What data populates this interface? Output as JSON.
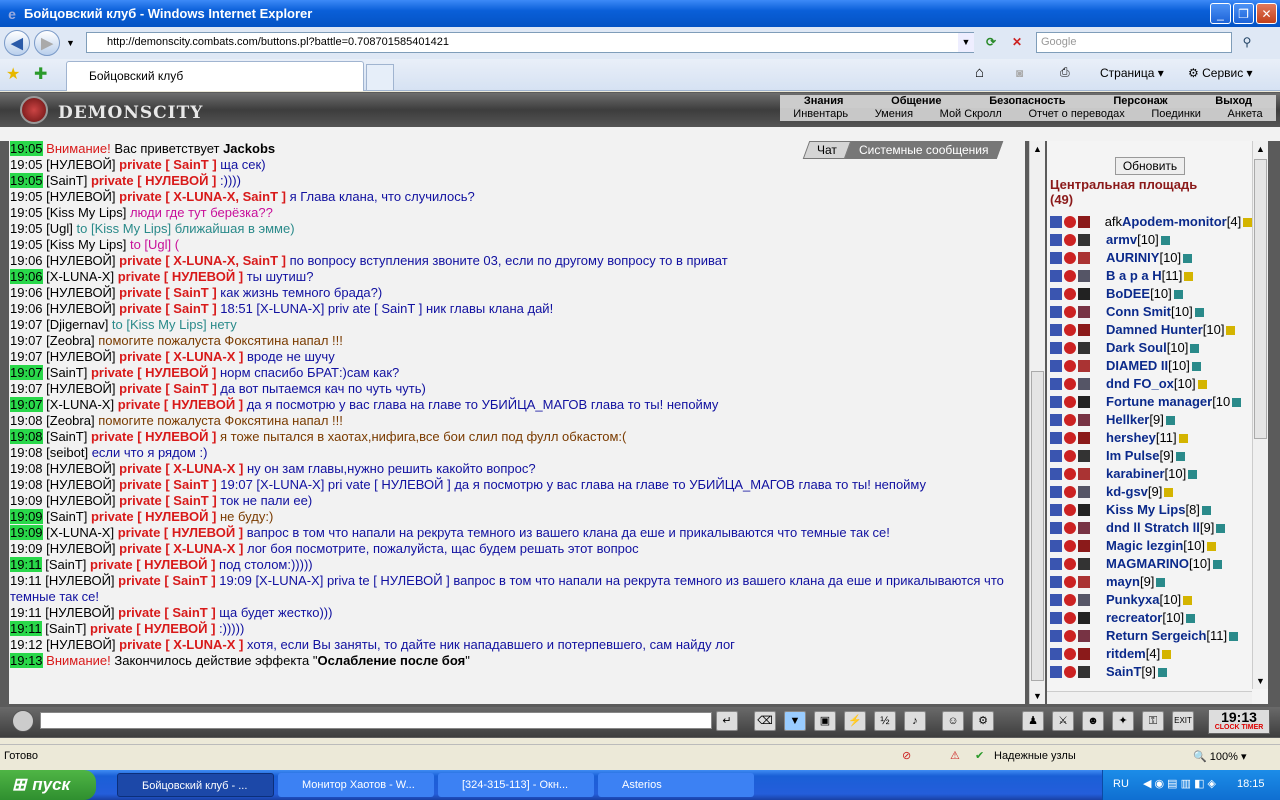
{
  "window": {
    "title": "Бойцовский клуб - Windows Internet Explorer"
  },
  "nav": {
    "url": "http://demonscity.combats.com/buttons.pl?battle=0.708701585401421",
    "search_placeholder": "Google"
  },
  "tabs": {
    "active": "Бойцовский клуб"
  },
  "commandbar": {
    "page": "Страница",
    "tools": "Сервис"
  },
  "game": {
    "logo": "DEMONSCITY",
    "topmenu": [
      "Знания",
      "Общение",
      "Безопасность",
      "Персонаж",
      "Выход"
    ],
    "submenu": [
      "Инвентарь",
      "Умения",
      "Мой Скролл",
      "Отчет о переводах",
      "Поединки",
      "Анкета"
    ],
    "chat_tabs": [
      "Чат",
      "Системные сообщения"
    ],
    "chat": [
      {
        "time": "19:05",
        "hl": true,
        "parts": [
          {
            "c": "wn",
            "t": "Внимание! "
          },
          {
            "c": "",
            "t": "Вас приветствует "
          },
          {
            "c": "b",
            "t": "Jackobs"
          }
        ]
      },
      {
        "time": "19:05",
        "hl": false,
        "parts": [
          {
            "c": "",
            "t": "[НУЛЕВОЙ] "
          },
          {
            "c": "pv",
            "t": "private [ SainT ]"
          },
          {
            "c": "tx",
            "t": " ща сек)"
          }
        ]
      },
      {
        "time": "19:05",
        "hl": true,
        "parts": [
          {
            "c": "",
            "t": "[SainT] "
          },
          {
            "c": "pv",
            "t": "private [ НУЛЕВОЙ ]"
          },
          {
            "c": "tx",
            "t": " :))))"
          }
        ]
      },
      {
        "time": "19:05",
        "hl": false,
        "parts": [
          {
            "c": "",
            "t": "[НУЛЕВОЙ] "
          },
          {
            "c": "pv",
            "t": "private [ X-LUNA-X, SainT ]"
          },
          {
            "c": "tx",
            "t": " я Глава клана, что случилось?"
          }
        ]
      },
      {
        "time": "19:05",
        "hl": false,
        "parts": [
          {
            "c": "",
            "t": "[Kiss My Lips] "
          },
          {
            "c": "mg",
            "t": "люди где тут берёзка??"
          }
        ]
      },
      {
        "time": "19:05",
        "hl": false,
        "parts": [
          {
            "c": "",
            "t": "[Ugl] "
          },
          {
            "c": "gr",
            "t": "to [Kiss My Lips] ближайшая в эмме)"
          }
        ]
      },
      {
        "time": "19:05",
        "hl": false,
        "parts": [
          {
            "c": "",
            "t": "[Kiss My Lips] "
          },
          {
            "c": "mg",
            "t": "to [Ugl] ("
          }
        ]
      },
      {
        "time": "19:06",
        "hl": false,
        "parts": [
          {
            "c": "",
            "t": "[НУЛЕВОЙ] "
          },
          {
            "c": "pv",
            "t": "private [ X-LUNA-X, SainT ]"
          },
          {
            "c": "tx",
            "t": " по вопросу вступления звоните 03, если по другому вопросу то в приват"
          }
        ]
      },
      {
        "time": "19:06",
        "hl": true,
        "parts": [
          {
            "c": "",
            "t": "[X-LUNA-X] "
          },
          {
            "c": "pv",
            "t": "private [ НУЛЕВОЙ ]"
          },
          {
            "c": "tx",
            "t": " ты шутиш?"
          }
        ]
      },
      {
        "time": "19:06",
        "hl": false,
        "parts": [
          {
            "c": "",
            "t": "[НУЛЕВОЙ] "
          },
          {
            "c": "pv",
            "t": "private [ SainT ]"
          },
          {
            "c": "tx",
            "t": " как жизнь темного брада?)"
          }
        ]
      },
      {
        "time": "19:06",
        "hl": false,
        "parts": [
          {
            "c": "",
            "t": "[НУЛЕВОЙ] "
          },
          {
            "c": "pv",
            "t": "private [ SainT ]"
          },
          {
            "c": "tx",
            "t": " 18:51 [X-LUNA-X] priv ate [ SainT ] ник главы клана дай!"
          }
        ]
      },
      {
        "time": "19:07",
        "hl": false,
        "parts": [
          {
            "c": "",
            "t": "[Djigernav] "
          },
          {
            "c": "gr",
            "t": "to [Kiss My Lips] нету"
          }
        ]
      },
      {
        "time": "19:07",
        "hl": false,
        "parts": [
          {
            "c": "",
            "t": "[Zeobra] "
          },
          {
            "c": "br",
            "t": "помогите пожалуста Фоксятина напал !!!"
          }
        ]
      },
      {
        "time": "19:07",
        "hl": false,
        "parts": [
          {
            "c": "",
            "t": "[НУЛЕВОЙ] "
          },
          {
            "c": "pv",
            "t": "private [ X-LUNA-X ]"
          },
          {
            "c": "tx",
            "t": " вроде не шучу"
          }
        ]
      },
      {
        "time": "19:07",
        "hl": true,
        "parts": [
          {
            "c": "",
            "t": "[SainT] "
          },
          {
            "c": "pv",
            "t": "private [ НУЛЕВОЙ ]"
          },
          {
            "c": "tx",
            "t": " норм спасибо БРАТ:)сам как?"
          }
        ]
      },
      {
        "time": "19:07",
        "hl": false,
        "parts": [
          {
            "c": "",
            "t": "[НУЛЕВОЙ] "
          },
          {
            "c": "pv",
            "t": "private [ SainT ]"
          },
          {
            "c": "tx",
            "t": " да вот пытаемся кач по чуть чуть)"
          }
        ]
      },
      {
        "time": "19:07",
        "hl": true,
        "parts": [
          {
            "c": "",
            "t": "[X-LUNA-X] "
          },
          {
            "c": "pv",
            "t": "private [ НУЛЕВОЙ ]"
          },
          {
            "c": "tx",
            "t": " да я посмотрю у вас глава на главе то УБИЙЦА_МАГОВ глава то ты! непойму"
          }
        ]
      },
      {
        "time": "19:08",
        "hl": false,
        "parts": [
          {
            "c": "",
            "t": "[Zeobra] "
          },
          {
            "c": "br",
            "t": "помогите пожалуста Фоксятина напал !!!"
          }
        ]
      },
      {
        "time": "19:08",
        "hl": true,
        "parts": [
          {
            "c": "",
            "t": "[SainT] "
          },
          {
            "c": "pv",
            "t": "private [ НУЛЕВОЙ ]"
          },
          {
            "c": "br",
            "t": " я тоже пытался в хаотах,нифига,все бои слил под фулл обкастом:("
          }
        ]
      },
      {
        "time": "19:08",
        "hl": false,
        "parts": [
          {
            "c": "",
            "t": "[seibot] "
          },
          {
            "c": "tx",
            "t": "если что я рядом :)"
          }
        ]
      },
      {
        "time": "19:08",
        "hl": false,
        "parts": [
          {
            "c": "",
            "t": "[НУЛЕВОЙ] "
          },
          {
            "c": "pv",
            "t": "private [ X-LUNA-X ]"
          },
          {
            "c": "tx",
            "t": " ну он зам главы,нужно решить какойто вопрос?"
          }
        ]
      },
      {
        "time": "19:08",
        "hl": false,
        "parts": [
          {
            "c": "",
            "t": "[НУЛЕВОЙ] "
          },
          {
            "c": "pv",
            "t": "private [ SainT ]"
          },
          {
            "c": "tx",
            "t": " 19:07 [X-LUNA-X] pri vate [ НУЛЕВОЙ ] да я посмотрю у вас глава на главе то УБИЙЦА_МАГОВ глава то ты! непойму"
          }
        ]
      },
      {
        "time": "19:09",
        "hl": false,
        "parts": [
          {
            "c": "",
            "t": "[НУЛЕВОЙ] "
          },
          {
            "c": "pv",
            "t": "private [ SainT ]"
          },
          {
            "c": "tx",
            "t": " ток не пали ее)"
          }
        ]
      },
      {
        "time": "19:09",
        "hl": true,
        "parts": [
          {
            "c": "",
            "t": "[SainT] "
          },
          {
            "c": "pv",
            "t": "private [ НУЛЕВОЙ ]"
          },
          {
            "c": "br",
            "t": " не буду:)"
          }
        ]
      },
      {
        "time": "19:09",
        "hl": true,
        "parts": [
          {
            "c": "",
            "t": "[X-LUNA-X] "
          },
          {
            "c": "pv",
            "t": "private [ НУЛЕВОЙ ]"
          },
          {
            "c": "tx",
            "t": " вапрос в том что напали на рекрута темного из вашего клана да еше и прикалываются что темные так се!"
          }
        ]
      },
      {
        "time": "19:09",
        "hl": false,
        "parts": [
          {
            "c": "",
            "t": "[НУЛЕВОЙ] "
          },
          {
            "c": "pv",
            "t": "private [ X-LUNA-X ]"
          },
          {
            "c": "tx",
            "t": " лог боя посмотрите, пожалуйста, щас будем решать этот вопрос"
          }
        ]
      },
      {
        "time": "19:11",
        "hl": true,
        "parts": [
          {
            "c": "",
            "t": "[SainT] "
          },
          {
            "c": "pv",
            "t": "private [ НУЛЕВОЙ ]"
          },
          {
            "c": "tx",
            "t": " под столом:)))))"
          }
        ]
      },
      {
        "time": "19:11",
        "hl": false,
        "parts": [
          {
            "c": "",
            "t": "[НУЛЕВОЙ] "
          },
          {
            "c": "pv",
            "t": "private [ SainT ]"
          },
          {
            "c": "tx",
            "t": " 19:09 [X-LUNA-X] priva te [ НУЛЕВОЙ ] вапрос в том что напали на рекрута темного из вашего клана да еше и прикалываются что темные так се!"
          }
        ]
      },
      {
        "time": "19:11",
        "hl": false,
        "parts": [
          {
            "c": "",
            "t": "[НУЛЕВОЙ] "
          },
          {
            "c": "pv",
            "t": "private [ SainT ]"
          },
          {
            "c": "tx",
            "t": " ща будет жестко)))"
          }
        ]
      },
      {
        "time": "19:11",
        "hl": true,
        "parts": [
          {
            "c": "",
            "t": "[SainT] "
          },
          {
            "c": "pv",
            "t": "private [ НУЛЕВОЙ ]"
          },
          {
            "c": "tx",
            "t": " :)))))"
          }
        ]
      },
      {
        "time": "19:12",
        "hl": false,
        "parts": [
          {
            "c": "",
            "t": "[НУЛЕВОЙ] "
          },
          {
            "c": "pv",
            "t": "private [ X-LUNA-X ]"
          },
          {
            "c": "tx",
            "t": " хотя, если Вы заняты, то дайте ник нападавшего и потерпевшего, сам найду лог"
          }
        ]
      },
      {
        "time": "19:13",
        "hl": true,
        "parts": [
          {
            "c": "wn",
            "t": "Внимание! "
          },
          {
            "c": "",
            "t": "Закончилось действие эффекта \""
          },
          {
            "c": "b",
            "t": "Ослабление после боя"
          },
          {
            "c": "",
            "t": "\""
          }
        ]
      }
    ],
    "refresh_label": "Обновить",
    "location": "Центральная площадь",
    "location_count": "(49)",
    "players": [
      {
        "pre": "afk ",
        "name": "Apodem-monitor",
        "lv": "[4]"
      },
      {
        "pre": "",
        "name": "armv",
        "lv": "[10]"
      },
      {
        "pre": "",
        "name": "AURINIY",
        "lv": "[10]"
      },
      {
        "pre": "",
        "name": "В а р а Н",
        "lv": "[11]"
      },
      {
        "pre": "",
        "name": "BoDEE",
        "lv": "[10]"
      },
      {
        "pre": "",
        "name": "Conn Smit",
        "lv": "[10]"
      },
      {
        "pre": "",
        "name": "Damned Hunter",
        "lv": "[10]"
      },
      {
        "pre": "",
        "name": "Dark Soul",
        "lv": "[10]"
      },
      {
        "pre": "",
        "name": "DIAMED II",
        "lv": "[10]"
      },
      {
        "pre": "",
        "name": "dnd FO_ox",
        "lv": "[10]"
      },
      {
        "pre": "",
        "name": "Fortune manager",
        "lv": "[10"
      },
      {
        "pre": "",
        "name": "Hellker",
        "lv": "[9]"
      },
      {
        "pre": "",
        "name": "hershey",
        "lv": "[11]"
      },
      {
        "pre": "",
        "name": "Im Pulse",
        "lv": "[9]"
      },
      {
        "pre": "",
        "name": "karabiner",
        "lv": "[10]"
      },
      {
        "pre": "",
        "name": "kd-gsv",
        "lv": "[9]"
      },
      {
        "pre": "",
        "name": "Kiss My Lips",
        "lv": "[8]"
      },
      {
        "pre": "",
        "name": "dnd ll Stratch ll",
        "lv": "[9]"
      },
      {
        "pre": "",
        "name": "Magic lezgin",
        "lv": "[10]"
      },
      {
        "pre": "",
        "name": "MAGMARINO",
        "lv": "[10]"
      },
      {
        "pre": "",
        "name": "mayn",
        "lv": "[9]"
      },
      {
        "pre": "",
        "name": "Punkyxa",
        "lv": "[10]"
      },
      {
        "pre": "",
        "name": "recreator",
        "lv": "[10]"
      },
      {
        "pre": "",
        "name": "Return Sergeich",
        "lv": "[11]"
      },
      {
        "pre": "",
        "name": "ritdem",
        "lv": "[4]"
      },
      {
        "pre": "",
        "name": "SainT",
        "lv": "[9]"
      }
    ],
    "clock": "19:13",
    "clock_sub1": "CLOCK",
    "clock_sub2": "TIMER"
  },
  "status": {
    "text": "Готово",
    "zone": "Надежные узлы",
    "zoom": "100%"
  },
  "taskbar": {
    "start": "пуск",
    "items": [
      "Бойцовский клуб - ...",
      "Монитор Хаотов - W...",
      "[324-315-113] - Окн...",
      "Asterios"
    ],
    "lang": "RU",
    "time": "18:15"
  }
}
